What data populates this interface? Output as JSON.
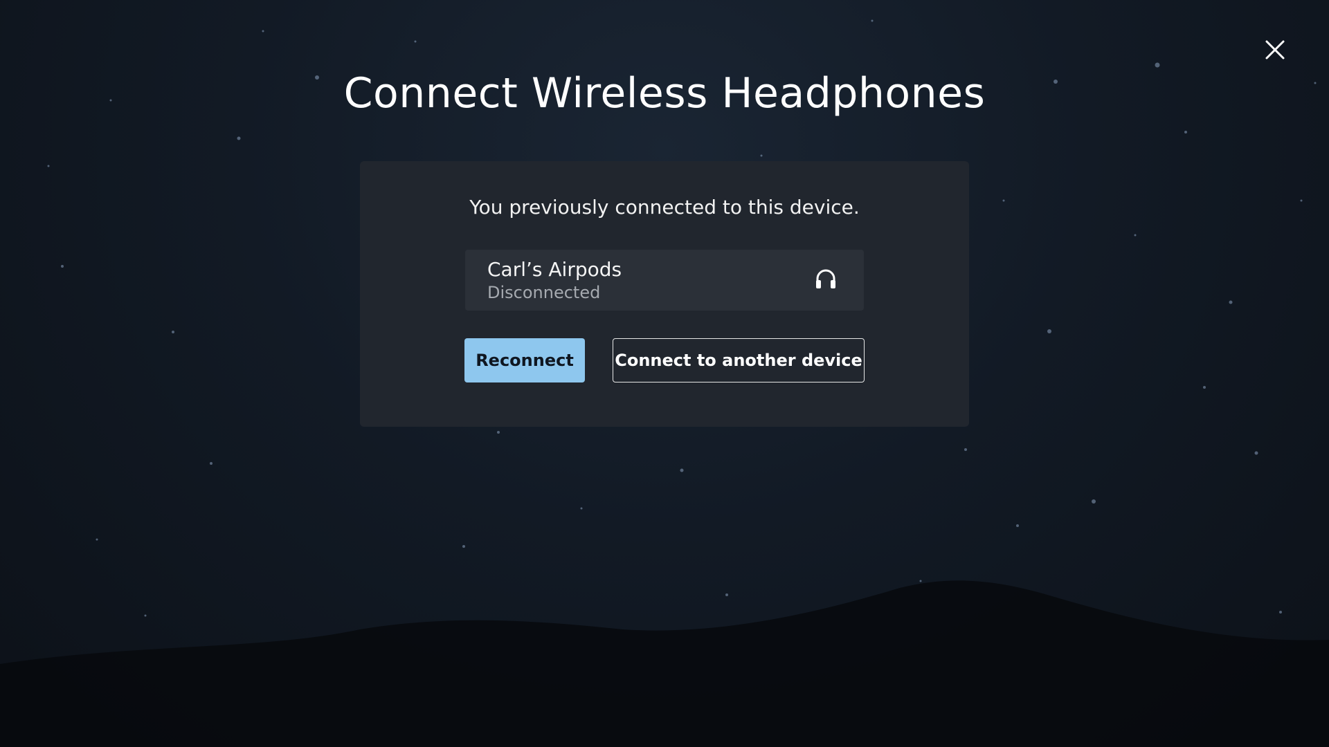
{
  "dialog": {
    "title": "Connect Wireless Headphones",
    "close_icon": "close-icon"
  },
  "panel": {
    "message": "You previously connected to this device.",
    "device": {
      "name": "Carl’s Airpods",
      "status": "Disconnected",
      "icon": "headphones-icon"
    },
    "buttons": {
      "reconnect": "Reconnect",
      "connect_other": "Connect to another device"
    }
  },
  "colors": {
    "accent": "#8ec7ee",
    "panel_bg": "#21262e",
    "card_bg": "#2b3038",
    "status_text": "#a6aab0"
  }
}
